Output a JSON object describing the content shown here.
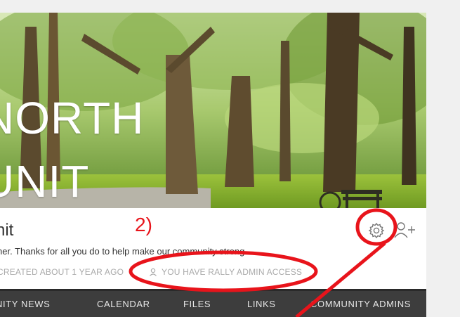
{
  "banner": {
    "title_line1": "NORTH",
    "title_line2": "UNIT"
  },
  "community": {
    "name": "nit",
    "description": "her. Thanks for all you do to help make our community strong.",
    "created": "CREATED ABOUT 1 YEAR AGO",
    "access": "YOU HAVE RALLY ADMIN ACCESS"
  },
  "icons": {
    "settings": "gear-icon",
    "add_member": "add-user-icon",
    "access": "user-icon"
  },
  "nav": {
    "items": [
      "NITY NEWS",
      "CALENDAR",
      "FILES",
      "LINKS",
      "COMMUNITY ADMINS"
    ]
  },
  "annotation": {
    "step_label": "2)",
    "color": "#e8141b"
  },
  "colors": {
    "nav_bg": "#3d3d3d",
    "muted_text": "#aaaaaa"
  }
}
